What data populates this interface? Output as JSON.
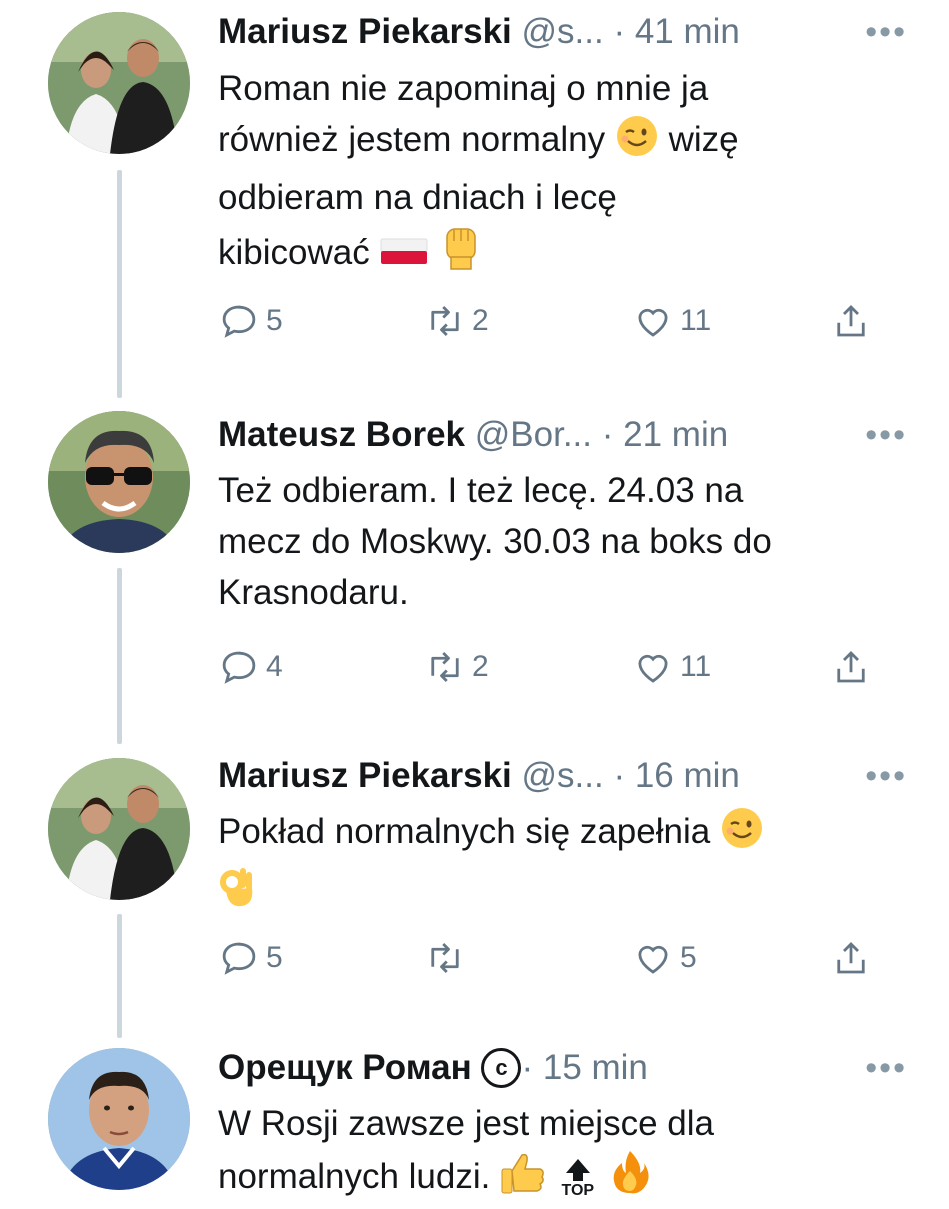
{
  "tweets": [
    {
      "name": "Mariusz Piekarski",
      "handle": "@s...",
      "time": "· 41 min",
      "body_lines": [
        "Roman nie zapominaj o mnie ja",
        "również jestem normalny",
        "wizę",
        "odbieram na dniach i lecę",
        "kibicować"
      ],
      "emojis": [
        "winking-face",
        "poland-flag",
        "raised-fist"
      ],
      "replies": "5",
      "retweets": "2",
      "likes": "11"
    },
    {
      "name": "Mateusz Borek",
      "handle": "@Bor...",
      "time": "· 21 min",
      "body_lines": [
        "Też odbieram. I też lecę. 24.03 na",
        "mecz do Moskwy. 30.03 na boks do",
        "Krasnodaru."
      ],
      "replies": "4",
      "retweets": "2",
      "likes": "11"
    },
    {
      "name": "Mariusz Piekarski",
      "handle": "@s...",
      "time": "· 16 min",
      "body_lines": [
        "Pokład normalnych się zapełnia"
      ],
      "emojis": [
        "winking-face",
        "ok-hand"
      ],
      "replies": "5",
      "retweets": "",
      "likes": "5"
    },
    {
      "name": "Орещук Роман",
      "badge": "c",
      "time": "· 15 min",
      "body_lines": [
        "W Rosji zawsze jest miejsce dla",
        "normalnych ludzi."
      ],
      "emojis": [
        "thumbs-up",
        "top-arrow",
        "fire"
      ],
      "top_label": "TOP"
    }
  ],
  "more_label": "•••",
  "colors": {
    "text": "#14171a",
    "secondary": "#657786",
    "thread_line": "#ccd6dd"
  }
}
